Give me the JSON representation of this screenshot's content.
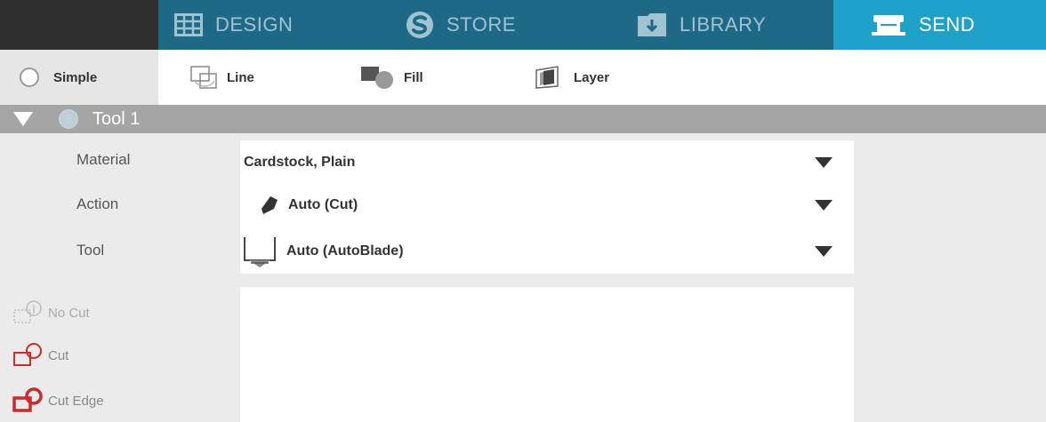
{
  "nav": {
    "tabs": [
      {
        "label": "DESIGN",
        "icon": "grid-icon"
      },
      {
        "label": "STORE",
        "icon": "store-s-icon"
      },
      {
        "label": "LIBRARY",
        "icon": "library-folder-icon"
      },
      {
        "label": "SEND",
        "icon": "cutter-machine-icon"
      }
    ],
    "active_tab": "SEND",
    "colors": {
      "bar": "#1e6a86",
      "active": "#1fa2c9",
      "inactive_text": "#9fc3d1"
    }
  },
  "modes": {
    "simple": "Simple",
    "line": "Line",
    "fill": "Fill",
    "layer": "Layer"
  },
  "tool_header": {
    "title": "Tool 1",
    "color": "#a5a5a5"
  },
  "settings": {
    "material_label": "Material",
    "action_label": "Action",
    "tool_label": "Tool",
    "material_value": "Cardstock, Plain",
    "action_value": "Auto (Cut)",
    "tool_value": "Auto (AutoBlade)"
  },
  "cut_options": {
    "no_cut": "No Cut",
    "cut": "Cut",
    "cut_edge": "Cut Edge",
    "cut_color": "#cc2b2b"
  }
}
